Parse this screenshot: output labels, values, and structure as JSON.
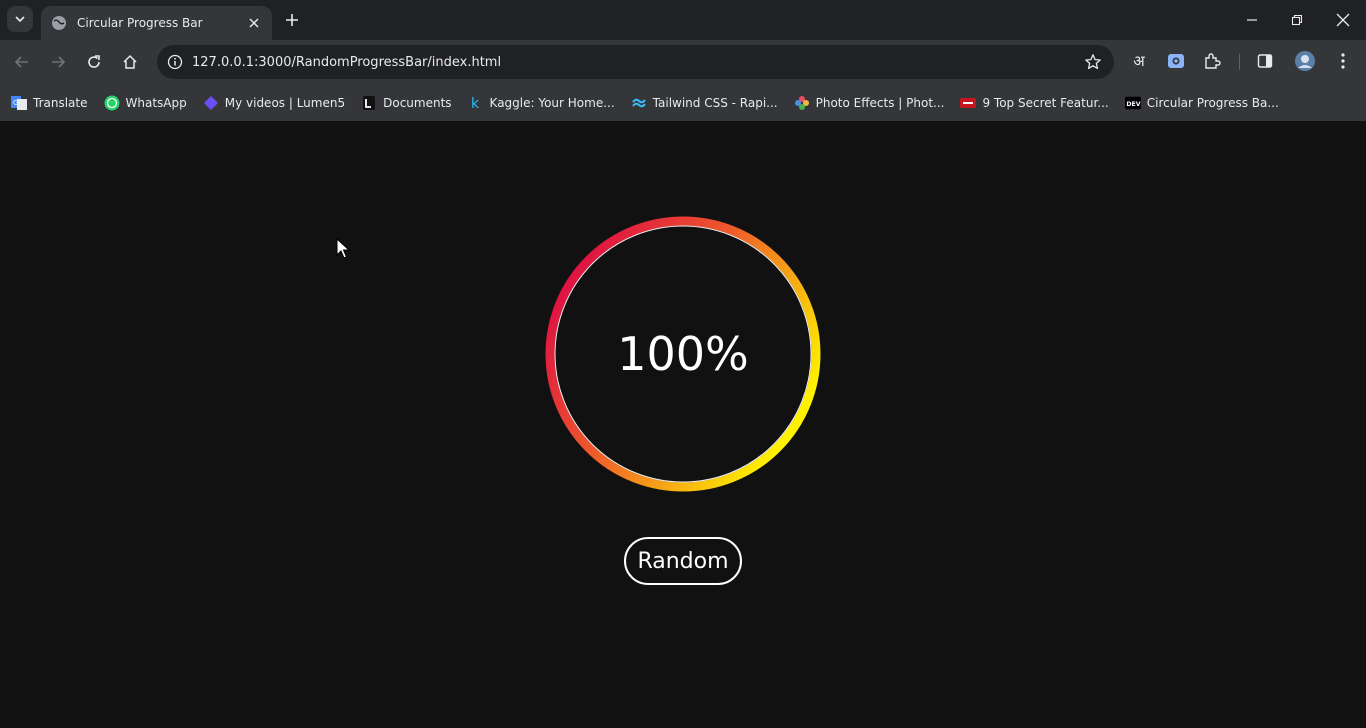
{
  "browser": {
    "tab_title": "Circular Progress Bar",
    "url": "127.0.0.1:3000/RandomProgressBar/index.html",
    "bookmarks": [
      {
        "label": "Translate",
        "icon": "google-translate-icon"
      },
      {
        "label": "WhatsApp",
        "icon": "whatsapp-icon"
      },
      {
        "label": "My videos | Lumen5",
        "icon": "lumen5-icon"
      },
      {
        "label": "Documents",
        "icon": "documents-icon"
      },
      {
        "label": "Kaggle: Your Home...",
        "icon": "kaggle-icon"
      },
      {
        "label": "Tailwind CSS - Rapi...",
        "icon": "tailwind-icon"
      },
      {
        "label": "Photo Effects | Phot...",
        "icon": "photo-effects-icon"
      },
      {
        "label": "9 Top Secret Featur...",
        "icon": "hud-icon"
      },
      {
        "label": "Circular Progress Ba...",
        "icon": "dev-icon"
      }
    ],
    "translate_glyph": "अ"
  },
  "page": {
    "progress": {
      "value": 100,
      "label": "100%",
      "gradient_start": "#dc0a45",
      "gradient_end": "#fff200"
    },
    "random_button": "Random"
  }
}
